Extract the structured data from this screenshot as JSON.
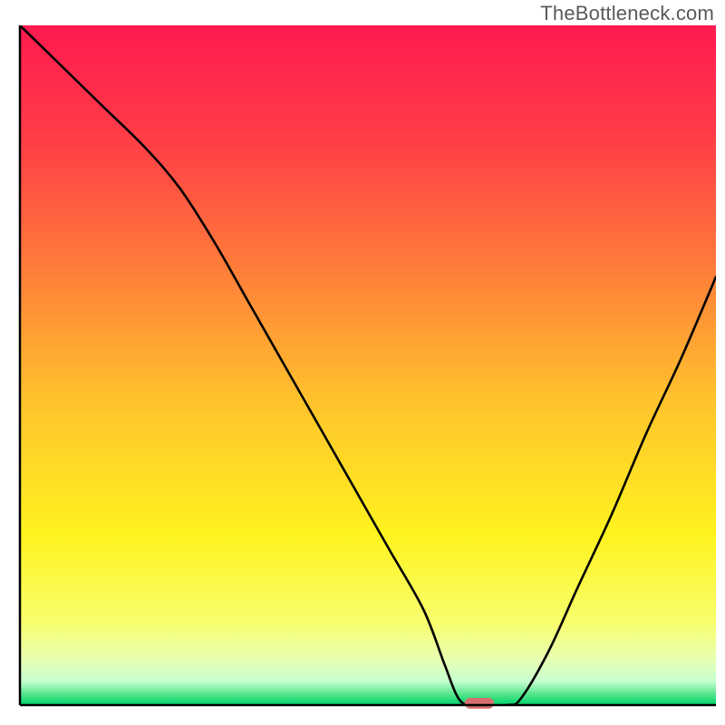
{
  "watermark": "TheBottleneck.com",
  "chart_data": {
    "type": "line",
    "title": "",
    "xlabel": "",
    "ylabel": "",
    "xlim": [
      0,
      100
    ],
    "ylim": [
      0,
      100
    ],
    "grid": false,
    "legend": false,
    "background_gradient": {
      "stops": [
        {
          "offset": 0.0,
          "color": "#ff1a4f"
        },
        {
          "offset": 0.17,
          "color": "#ff3e47"
        },
        {
          "offset": 0.35,
          "color": "#ff7a3a"
        },
        {
          "offset": 0.55,
          "color": "#ffc22d"
        },
        {
          "offset": 0.75,
          "color": "#fff31f"
        },
        {
          "offset": 0.88,
          "color": "#f7ff6e"
        },
        {
          "offset": 0.93,
          "color": "#e9ffb0"
        },
        {
          "offset": 0.965,
          "color": "#c7ffd0"
        },
        {
          "offset": 0.985,
          "color": "#4fe489"
        },
        {
          "offset": 1.0,
          "color": "#00d26a"
        }
      ]
    },
    "series": [
      {
        "name": "bottleneck-curve",
        "color": "#000000",
        "x": [
          0,
          6,
          12,
          18,
          23,
          28,
          33,
          38,
          43,
          48,
          53,
          58,
          61,
          63,
          65,
          70,
          72,
          76,
          80,
          85,
          90,
          95,
          100
        ],
        "y": [
          100,
          94,
          88,
          82,
          76,
          68,
          59,
          50,
          41,
          32,
          23,
          14,
          6,
          1,
          0,
          0,
          1,
          8,
          17,
          28,
          40,
          51,
          63
        ]
      }
    ],
    "marker": {
      "name": "optimum-marker",
      "x": 66,
      "y": 0,
      "width": 4.2,
      "height": 1.6,
      "color": "#d6706f"
    },
    "axes": {
      "color": "#000000",
      "width": 2.5
    }
  }
}
